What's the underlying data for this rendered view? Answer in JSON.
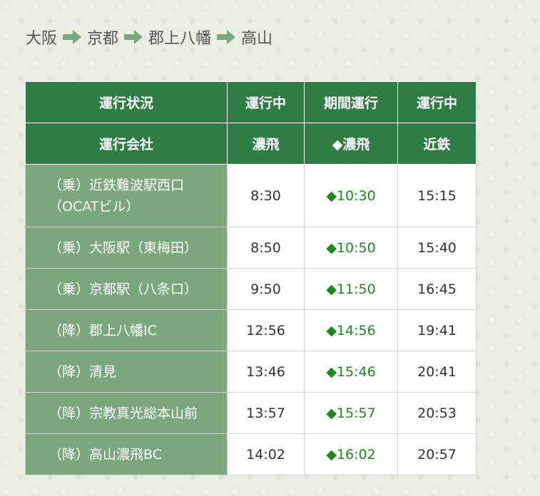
{
  "route": {
    "stops": [
      "大阪",
      "京都",
      "郡上八幡",
      "高山"
    ],
    "arrow_color": "#7aa87c"
  },
  "table": {
    "header_rows": [
      {
        "label": "運行状況",
        "cells": [
          "運行中",
          "期間運行",
          "運行中"
        ]
      },
      {
        "label": "運行会社",
        "cells": [
          "濃飛",
          "◆濃飛",
          "近鉄"
        ]
      }
    ],
    "rows": [
      {
        "stop_lines": [
          "（乗）近鉄難波駅西口",
          "（OCATビル）"
        ],
        "times": [
          "8:30",
          "◆10:30",
          "15:15"
        ]
      },
      {
        "stop_lines": [
          "（乗）大阪駅（東梅田）"
        ],
        "times": [
          "8:50",
          "◆10:50",
          "15:40"
        ]
      },
      {
        "stop_lines": [
          "（乗）京都駅（八条口）"
        ],
        "times": [
          "9:50",
          "◆11:50",
          "16:45"
        ]
      },
      {
        "stop_lines": [
          "（降）郡上八幡IC"
        ],
        "times": [
          "12:56",
          "◆14:56",
          "19:41"
        ]
      },
      {
        "stop_lines": [
          "（降）清見"
        ],
        "times": [
          "13:46",
          "◆15:46",
          "20:41"
        ]
      },
      {
        "stop_lines": [
          "（降）宗教真光総本山前"
        ],
        "times": [
          "13:57",
          "◆15:57",
          "20:53"
        ]
      },
      {
        "stop_lines": [
          "（降）高山濃飛BC"
        ],
        "times": [
          "14:02",
          "◆16:02",
          "20:57"
        ]
      }
    ],
    "colors": {
      "header_bg": "#2e7d45",
      "stop_bg": "#7aa87c",
      "special_time": "#1b8a1b"
    }
  }
}
